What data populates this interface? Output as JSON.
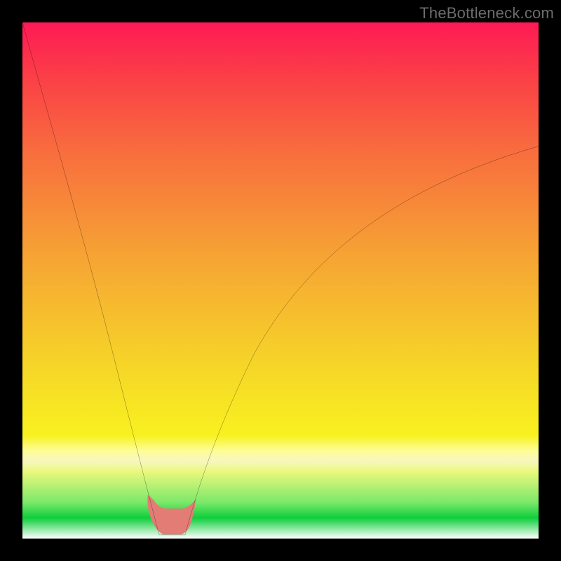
{
  "watermark": "TheBottleneck.com",
  "colors": {
    "page_bg": "#000000",
    "curve": "#000000",
    "blob": "#e37c75",
    "gradient_stops": [
      "#fe1a55",
      "#fb3d47",
      "#f86d3e",
      "#f6a334",
      "#f6d229",
      "#f8f120",
      "#fdfd97",
      "#f8f6c0",
      "#eaf87d",
      "#7be86a",
      "#0ece3c",
      "#ffffff"
    ]
  },
  "chart_data": {
    "type": "line",
    "title": "",
    "xlabel": "",
    "ylabel": "",
    "xlim": [
      0,
      100
    ],
    "ylim": [
      0,
      100
    ],
    "grid": false,
    "legend": null,
    "annotations": [],
    "series": [
      {
        "name": "left-branch",
        "x": [
          0,
          2,
          4,
          6,
          8,
          10,
          12,
          14,
          16,
          18,
          20,
          22,
          23,
          24,
          25,
          26.5
        ],
        "y": [
          100,
          92,
          84,
          77,
          70,
          62,
          55,
          48,
          41,
          34,
          26,
          18,
          14,
          10,
          6,
          0
        ]
      },
      {
        "name": "floor",
        "x": [
          26.5,
          28,
          30,
          31.5
        ],
        "y": [
          0,
          0,
          0,
          0
        ]
      },
      {
        "name": "right-branch",
        "x": [
          31.5,
          33,
          35,
          38,
          42,
          47,
          53,
          60,
          68,
          77,
          87,
          100
        ],
        "y": [
          0,
          6,
          12,
          20,
          29,
          38,
          46,
          53,
          60,
          66,
          71,
          76
        ]
      }
    ],
    "markers": [
      {
        "name": "blob",
        "shape": "rounded",
        "color": "#e37c75",
        "cx": 29,
        "cy": 1.5,
        "approx_points": [
          {
            "x": 24.5,
            "y": 6
          },
          {
            "x": 25.5,
            "y": 3
          },
          {
            "x": 27,
            "y": 0.5
          },
          {
            "x": 30,
            "y": 0.5
          },
          {
            "x": 32,
            "y": 3
          },
          {
            "x": 33,
            "y": 6
          },
          {
            "x": 31,
            "y": 5
          },
          {
            "x": 29,
            "y": 5
          },
          {
            "x": 27,
            "y": 5
          }
        ]
      }
    ]
  }
}
